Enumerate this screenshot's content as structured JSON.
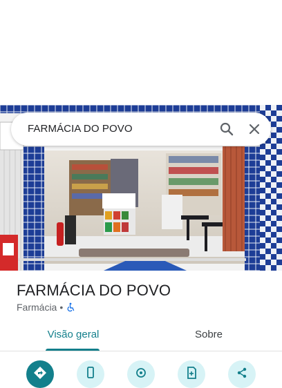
{
  "search": {
    "value": "FARMÁCIA DO POVO",
    "search_icon": "search-icon",
    "close_icon": "close-icon"
  },
  "place": {
    "name": "FARMÁCIA DO POVO",
    "category": "Farmácia",
    "separator": "•",
    "accessibility_icon": "wheelchair-icon"
  },
  "tabs": [
    {
      "label": "Visão geral",
      "active": true
    },
    {
      "label": "Sobre",
      "active": false
    }
  ],
  "actions": [
    {
      "icon": "directions-icon",
      "primary": true
    },
    {
      "icon": "phone-icon",
      "primary": false
    },
    {
      "icon": "location-icon",
      "primary": false
    },
    {
      "icon": "save-icon",
      "primary": false
    },
    {
      "icon": "share-icon",
      "primary": false
    }
  ],
  "colors": {
    "accent": "#137f8b",
    "action_bg": "#d7f3f6",
    "tile_blue": "#1b3a8c"
  }
}
